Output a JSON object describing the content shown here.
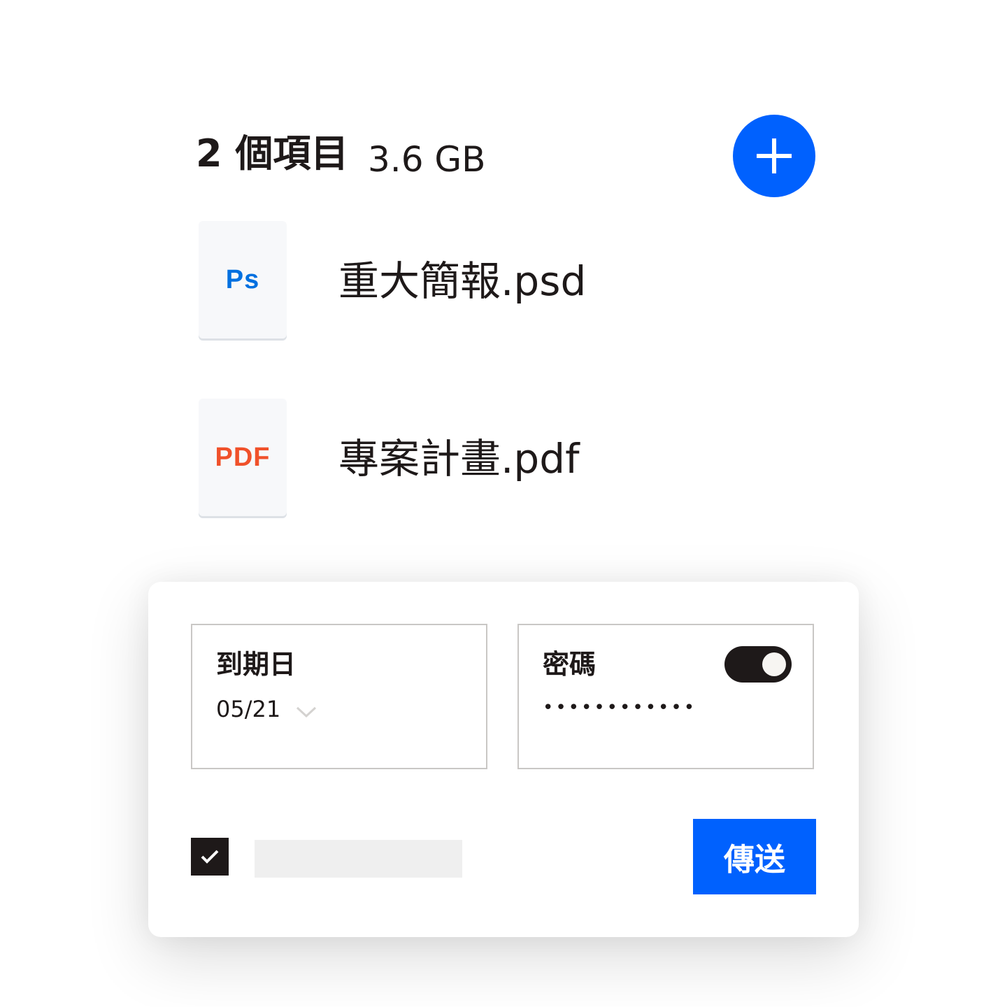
{
  "header": {
    "count_title": "2 個項目",
    "total_size": "3.6 GB",
    "add_icon": "plus-icon"
  },
  "files": [
    {
      "type_label": "Ps",
      "type_color": "#0070e0",
      "name": "重大簡報.psd"
    },
    {
      "type_label": "PDF",
      "type_color": "#f0512a",
      "name": "專案計畫.pdf"
    }
  ],
  "share_panel": {
    "expiry": {
      "label": "到期日",
      "value": "05/21",
      "icon": "chevron-down-icon"
    },
    "password": {
      "label": "密碼",
      "toggle_on": true,
      "masked_value": "••••••••••••"
    },
    "checkbox_checked": true,
    "send_label": "傳送"
  },
  "colors": {
    "accent": "#0061fe",
    "text": "#1e1919",
    "border": "#c9c7c5"
  }
}
